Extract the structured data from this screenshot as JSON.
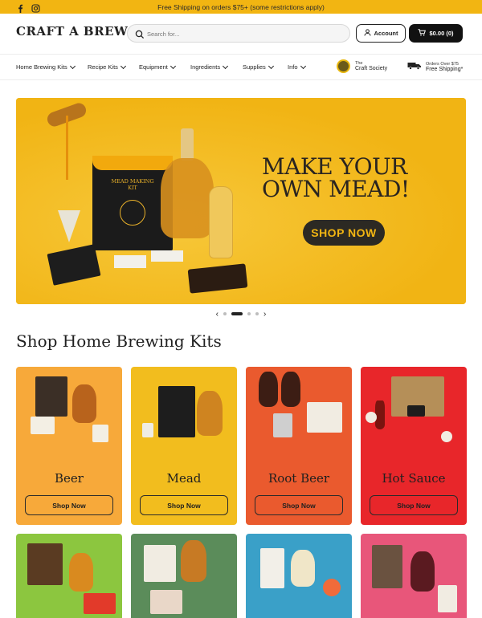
{
  "announcement": {
    "text": "Free Shipping on orders $75+ (some restrictions apply)",
    "social": [
      {
        "icon": "facebook-icon"
      },
      {
        "icon": "instagram-icon"
      }
    ],
    "bg_color": "#f2b512"
  },
  "header": {
    "logo_text": "CRAFT A BREW",
    "search_placeholder": "Search for...",
    "account_label": "Account",
    "cart_label": "$0.00 (0)"
  },
  "nav": {
    "items": [
      {
        "label": "Home Brewing Kits"
      },
      {
        "label": "Recipe Kits"
      },
      {
        "label": "Equipment"
      },
      {
        "label": "Ingredients"
      },
      {
        "label": "Supplies"
      },
      {
        "label": "Info"
      }
    ],
    "society": {
      "line1": "The",
      "line2": "Craft Society"
    },
    "shipping": {
      "line1": "Orders Over $75",
      "line2": "Free Shipping*"
    }
  },
  "hero": {
    "headline": "MAKE YOUR OWN MEAD!",
    "cta": "SHOP NOW",
    "kit_label": "MEAD MAKING KIT",
    "accent_color": "#f4bd1a",
    "slide_count": 5,
    "active_slide": 2
  },
  "section": {
    "title": "Shop Home Brewing Kits"
  },
  "products": [
    {
      "name": "Beer",
      "cta": "Shop Now",
      "color": "#f7a93a"
    },
    {
      "name": "Mead",
      "cta": "Shop Now",
      "color": "#f2bd1e"
    },
    {
      "name": "Root Beer",
      "cta": "Shop Now",
      "color": "#ea5a2e"
    },
    {
      "name": "Hot Sauce",
      "cta": "Shop Now",
      "color": "#e8262a"
    }
  ],
  "products_row2": [
    {
      "color": "#8cc63f"
    },
    {
      "color": "#5b8c5a"
    },
    {
      "color": "#3aa0c8"
    },
    {
      "color": "#e8567a"
    }
  ]
}
